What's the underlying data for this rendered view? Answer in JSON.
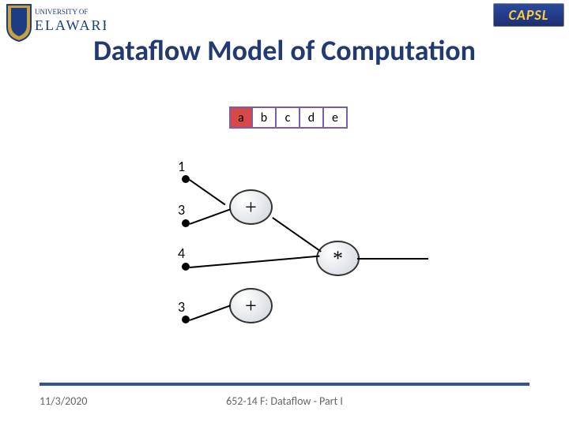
{
  "logos": {
    "ud_alt": "University of Delaware",
    "capsl_text": "CAPSL"
  },
  "title": "Dataflow Model of Computation",
  "boxes": [
    "a",
    "b",
    "c",
    "d",
    "e"
  ],
  "left_labels": {
    "one": "1",
    "three_a": "3",
    "four": "4",
    "three_b": "3"
  },
  "operators": {
    "plus1": "+",
    "star": "*",
    "plus2": "+"
  },
  "footer": {
    "date": "11/3/2020",
    "course": "652-14 F: Dataflow - Part I"
  }
}
